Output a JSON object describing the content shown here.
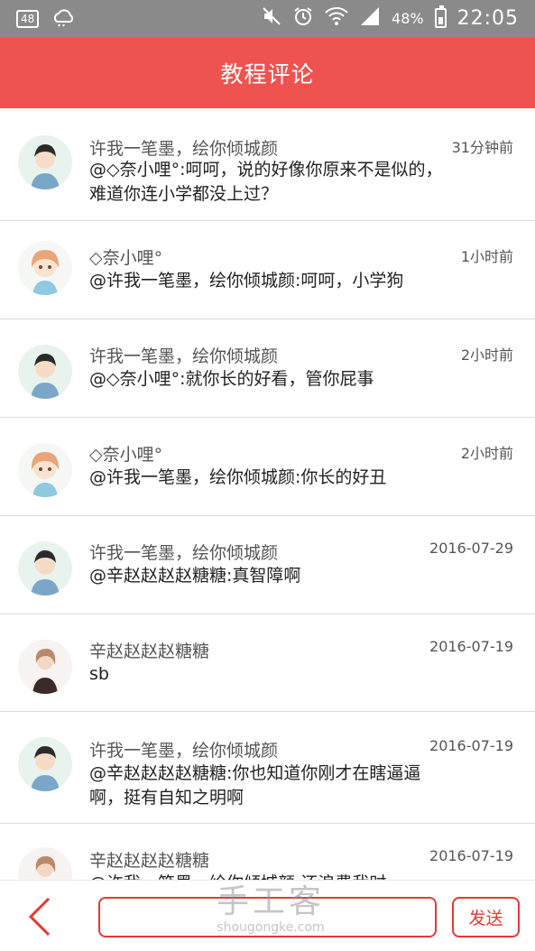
{
  "status_bar": {
    "badge": "48",
    "battery_percent": "48%",
    "battery_level": 0.48,
    "time": "22:05",
    "icons": [
      "notification-badge-icon",
      "weather-icon",
      "mute-icon",
      "alarm-icon",
      "wifi-icon",
      "signal-icon",
      "battery-icon"
    ]
  },
  "header": {
    "title": "教程评论"
  },
  "comments": [
    {
      "name": "许我一笔墨，绘你倾城颜",
      "time": "31分钟前",
      "text": "@◇奈小哩°:呵呵，说的好像你原来不是似的，难道你连小学都没上过？",
      "avatar": "boy"
    },
    {
      "name": "◇奈小哩°",
      "time": "1小时前",
      "text": "@许我一笔墨，绘你倾城颜:呵呵，小学狗",
      "avatar": "girl"
    },
    {
      "name": "许我一笔墨，绘你倾城颜",
      "time": "2小时前",
      "text": "@◇奈小哩°:就你长的好看，管你屁事",
      "avatar": "boy"
    },
    {
      "name": "◇奈小哩°",
      "time": "2小时前",
      "text": "@许我一笔墨，绘你倾城颜:你长的好丑",
      "avatar": "girl"
    },
    {
      "name": "许我一笔墨，绘你倾城颜",
      "time": "2016-07-29",
      "text": "@辛赵赵赵赵糖糖:真智障啊",
      "avatar": "boy"
    },
    {
      "name": "辛赵赵赵赵糖糖",
      "time": "2016-07-19",
      "text": "sb",
      "avatar": "woman"
    },
    {
      "name": "许我一笔墨，绘你倾城颜",
      "time": "2016-07-19",
      "text": "@辛赵赵赵赵糖糖:你也知道你刚才在瞎逼逼啊，挺有自知之明啊",
      "avatar": "boy"
    },
    {
      "name": "辛赵赵赵赵糖糖",
      "time": "2016-07-19",
      "text": "@许我一笔墨，绘你倾城颜:还浪费我时",
      "avatar": "woman"
    }
  ],
  "footer": {
    "input_value": "",
    "input_placeholder": "",
    "send_label": "发送",
    "back_icon": "chevron-left-icon"
  },
  "watermark": {
    "main": "手工客",
    "sub": "shougongke.com"
  },
  "colors": {
    "accent": "#ef5350",
    "status_bar": "#8a8a8a",
    "divider": "#dcdcdc"
  }
}
